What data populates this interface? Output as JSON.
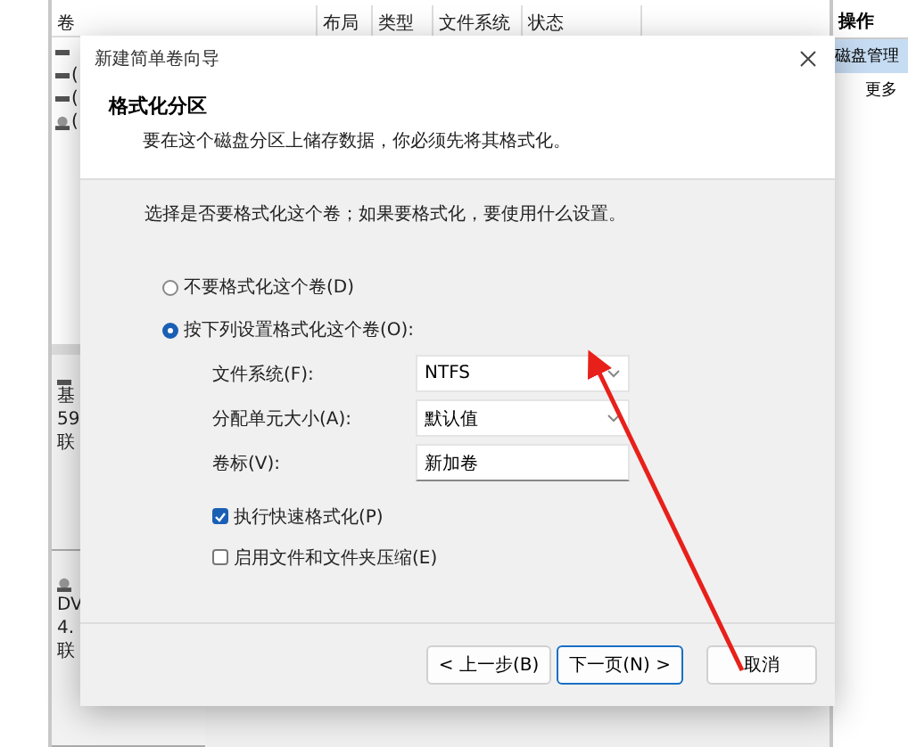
{
  "background": {
    "columns": [
      "卷",
      "布局",
      "类型",
      "文件系统",
      "状态"
    ],
    "rows": [
      {
        "kind": "drive",
        "text": ""
      },
      {
        "kind": "drive",
        "text": "("
      },
      {
        "kind": "drive",
        "text": "("
      },
      {
        "kind": "optical",
        "text": "("
      }
    ],
    "disks": [
      {
        "kind": "drive",
        "lines": [
          "基",
          "59",
          "联"
        ]
      },
      {
        "kind": "optical",
        "lines": [
          "DV",
          "4.",
          "联"
        ]
      }
    ],
    "actions": {
      "title": "操作",
      "items": [
        {
          "label": "磁盘管理",
          "selected": true
        },
        {
          "label": "更多",
          "selected": false
        }
      ]
    }
  },
  "dialog": {
    "title": "新建简单卷向导",
    "heading": "格式化分区",
    "subtitle": "要在这个磁盘分区上储存数据，你必须先将其格式化。",
    "prompt": "选择是否要格式化这个卷；如果要格式化，要使用什么设置。",
    "radios": [
      {
        "label": "不要格式化这个卷(D)",
        "selected": false
      },
      {
        "label": "按下列设置格式化这个卷(O):",
        "selected": true
      }
    ],
    "fields": [
      {
        "kind": "dropdown",
        "label": "文件系统(F):",
        "value": "NTFS"
      },
      {
        "kind": "dropdown",
        "label": "分配单元大小(A):",
        "value": "默认值"
      },
      {
        "kind": "text",
        "label": "卷标(V):",
        "value": "新加卷"
      }
    ],
    "checkboxes": [
      {
        "label": "执行快速格式化(P)",
        "checked": true
      },
      {
        "label": "启用文件和文件夹压缩(E)",
        "checked": false
      }
    ],
    "buttons": [
      {
        "label": "< 上一步(B)",
        "default": false
      },
      {
        "label": "下一页(N) >",
        "default": true
      },
      {
        "label": "取消",
        "default": false
      }
    ]
  }
}
